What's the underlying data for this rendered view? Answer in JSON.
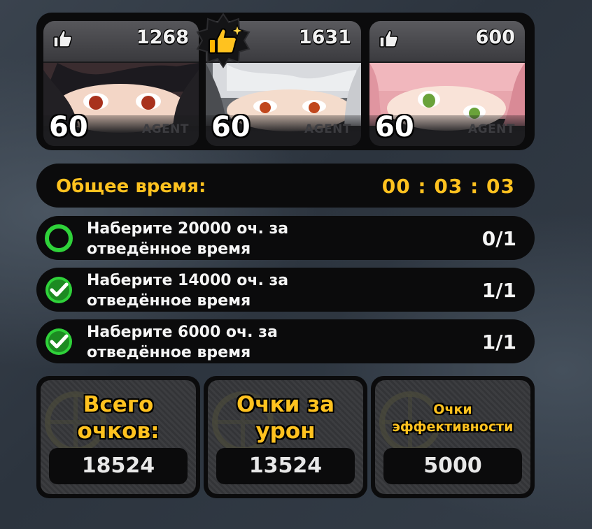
{
  "agents": [
    {
      "likes": "1268",
      "level": "60",
      "tag": "AGENT",
      "best": false
    },
    {
      "likes": "1631",
      "level": "60",
      "tag": "AGENT",
      "best": true
    },
    {
      "likes": "600",
      "level": "60",
      "tag": "AGENT",
      "best": false
    }
  ],
  "time": {
    "label": "Общее время:",
    "value": "00 : 03 : 03"
  },
  "missions": [
    {
      "text": "Наберите 20000 оч. за отведённое время",
      "count": "0/1",
      "done": false
    },
    {
      "text": "Наберите 14000 оч. за отведённое время",
      "count": "1/1",
      "done": true
    },
    {
      "text": "Наберите 6000 оч. за отведённое время",
      "count": "1/1",
      "done": true
    }
  ],
  "scores": [
    {
      "title": "Всего очков:",
      "value": "18524"
    },
    {
      "title": "Очки за урон",
      "value": "13524"
    },
    {
      "title": "Очки эффективности",
      "value": "5000"
    }
  ],
  "colors": {
    "accent": "#ffc21f",
    "check": "#2fd23a",
    "panel": "#0b0b0c"
  },
  "icons": {
    "like": "thumbs-up-icon",
    "best": "gold-thumbs-up-badge-icon",
    "done": "checkmark-circle-icon",
    "todo": "empty-circle-icon"
  }
}
